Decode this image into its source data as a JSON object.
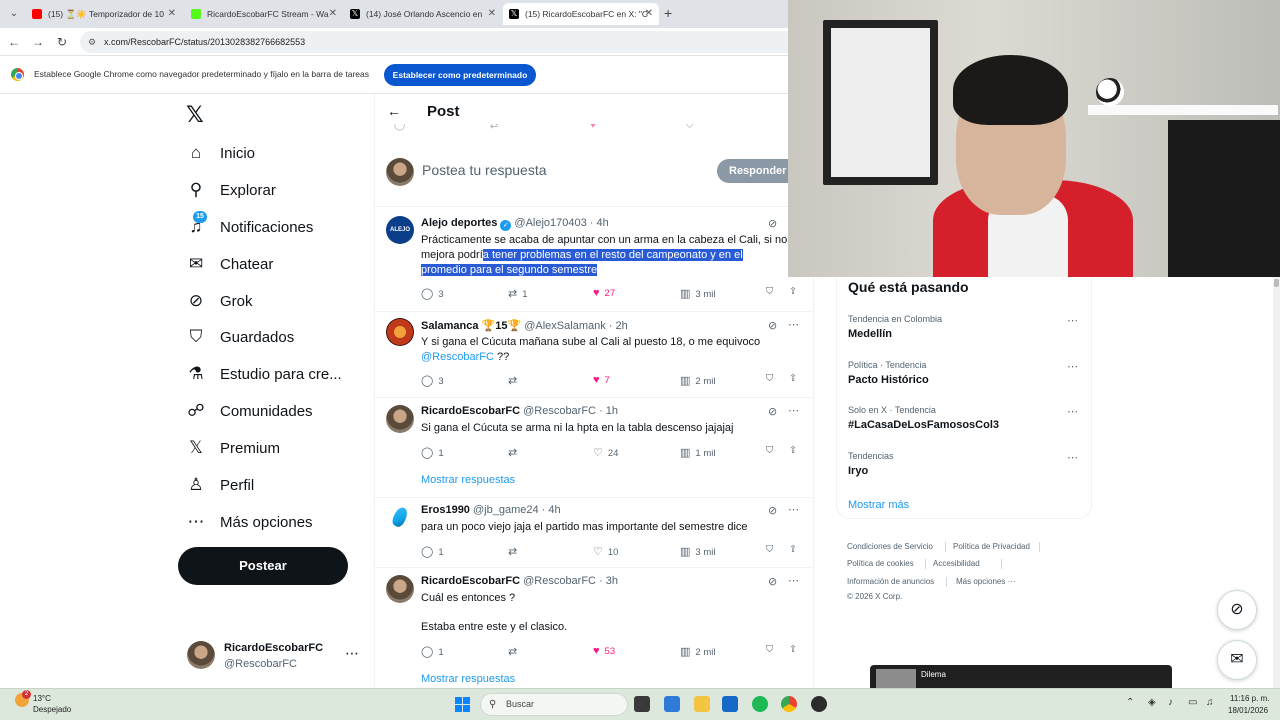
{
  "browser": {
    "tabs": [
      {
        "title": "(15) ⏳☀️ Temporizador de 10",
        "favicon_color": "#ff0000"
      },
      {
        "title": "RicardoEscobarFC Stream - Wa",
        "favicon_color": "#53fc18"
      },
      {
        "title": "(14) José Orlando Ascencio en",
        "favicon_color": "#000000"
      },
      {
        "title": "(15) RicardoEscobarFC en X: \"C",
        "favicon_color": "#000000"
      }
    ],
    "url": "x.com/RescobarFC/status/2013028382766682553",
    "infobar_text": "Establece Google Chrome como navegador predeterminado y fíjalo en la barra de tareas",
    "infobar_button": "Establecer como predeterminado"
  },
  "sidebar": {
    "logo": "𝕏",
    "items": [
      {
        "label": "Inicio",
        "icon": "home-icon",
        "glyph": "⌂"
      },
      {
        "label": "Explorar",
        "icon": "search-icon",
        "glyph": "⚲"
      },
      {
        "label": "Notificaciones",
        "icon": "bell-icon",
        "glyph": "🔔",
        "badge": "15"
      },
      {
        "label": "Chatear",
        "icon": "mail-icon",
        "glyph": "✉"
      },
      {
        "label": "Grok",
        "icon": "grok-icon",
        "glyph": "⊘"
      },
      {
        "label": "Guardados",
        "icon": "bookmark-icon",
        "glyph": "🔖"
      },
      {
        "label": "Estudio para cre...",
        "icon": "flask-icon",
        "glyph": "⚗"
      },
      {
        "label": "Comunidades",
        "icon": "people-icon",
        "glyph": "👥"
      },
      {
        "label": "Premium",
        "icon": "x-premium-icon",
        "glyph": "𝕏"
      },
      {
        "label": "Perfil",
        "icon": "person-icon",
        "glyph": "👤"
      },
      {
        "label": "Más opciones",
        "icon": "more-circle-icon",
        "glyph": "⋯"
      }
    ],
    "post_button": "Postear",
    "account": {
      "name": "RicardoEscobarFC",
      "handle": "@RescobarFC"
    }
  },
  "main": {
    "title": "Post",
    "reply_placeholder": "Postea tu respuesta",
    "reply_button": "Responder",
    "tweets": [
      {
        "name": "Alejo deportes",
        "verified": true,
        "handle": "@Alejo170403",
        "time": "4h",
        "text_plain": "Prácticamente se acaba de apuntar con un arma en la cabeza el Cali, si no mejora podrí",
        "text_highlight": "a tener problemas en el resto del campeonato y en el promedio para el segundo semestre",
        "replies": "3",
        "retweets": "1",
        "likes": "27",
        "views": "3 mil",
        "liked": true
      },
      {
        "name": "Salamanca 🏆15🏆",
        "handle": "@AlexSalamank",
        "time": "2h",
        "text": "Y si gana el Cúcuta mañana sube al Cali al puesto 18, o me equivoco",
        "mention": "@RescobarFC",
        "text_after": " ??",
        "replies": "3",
        "retweets": "",
        "likes": "7",
        "views": "2 mil",
        "liked": true
      },
      {
        "name": "RicardoEscobarFC",
        "handle": "@RescobarFC",
        "time": "1h",
        "text": "Si gana el Cúcuta se arma ni la hpta en la tabla descenso jajajaj",
        "replies": "1",
        "retweets": "",
        "likes": "24",
        "views": "1 mil",
        "liked": false,
        "show_replies": "Mostrar respuestas"
      },
      {
        "name": "Eros1990",
        "handle": "@jb_game24",
        "time": "4h",
        "text": "para un poco viejo jaja el partido mas importante del semestre dice",
        "replies": "1",
        "retweets": "",
        "likes": "10",
        "views": "3 mil",
        "liked": false
      },
      {
        "name": "RicardoEscobarFC",
        "handle": "@RescobarFC",
        "time": "3h",
        "text": "Cuál es entonces ?",
        "text2": "Estaba entre este y el clasico.",
        "replies": "1",
        "retweets": "",
        "likes": "53",
        "views": "2 mil",
        "liked": true,
        "show_replies": "Mostrar respuestas"
      }
    ]
  },
  "trends": {
    "title": "Qué está pasando",
    "items": [
      {
        "meta": "Tendencia en Colombia",
        "name": "Medellín"
      },
      {
        "meta": "Política · Tendencia",
        "name": "Pacto Histórico"
      },
      {
        "meta": "Solo en X · Tendencia",
        "name": "#LaCasaDeLosFamososCol3"
      },
      {
        "meta": "Tendencias",
        "name": "Iryo"
      }
    ],
    "show_more": "Mostrar más",
    "footer": {
      "terms": "Condiciones de Servicio",
      "privacy": "Política de Privacidad",
      "cookies": "Política de cookies",
      "accessibility": "Accesibilidad",
      "ads": "Información de anuncios",
      "more": "Más opciones ···",
      "copyright": "© 2026 X Corp."
    }
  },
  "media_popup": {
    "title": "Dilema"
  },
  "taskbar": {
    "weather_temp": "13°C",
    "weather_desc": "Despejado",
    "weather_badge": "2",
    "search": "Buscar",
    "time": "11:16 p. m.",
    "date": "18/01/2026"
  }
}
